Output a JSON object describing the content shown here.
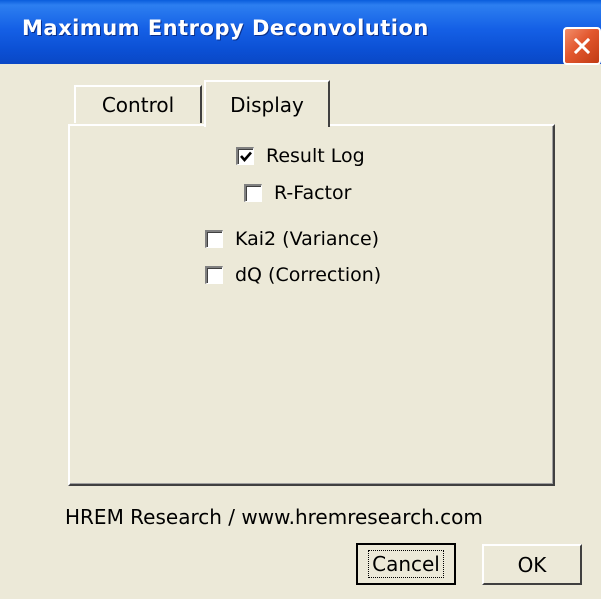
{
  "window": {
    "title": "Maximum Entropy Deconvolution",
    "close_icon": "close-icon"
  },
  "tabs": [
    {
      "label": "Control",
      "selected": false
    },
    {
      "label": "Display",
      "selected": true
    }
  ],
  "display_options": [
    {
      "label": "Result Log",
      "checked": true
    },
    {
      "label": "R-Factor",
      "checked": false
    },
    {
      "label": "Kai2 (Variance)",
      "checked": false
    },
    {
      "label": "dQ (Correction)",
      "checked": false
    }
  ],
  "footer": {
    "credit": "HREM Research / www.hremresearch.com"
  },
  "buttons": {
    "cancel_label": "Cancel",
    "ok_label": "OK"
  }
}
